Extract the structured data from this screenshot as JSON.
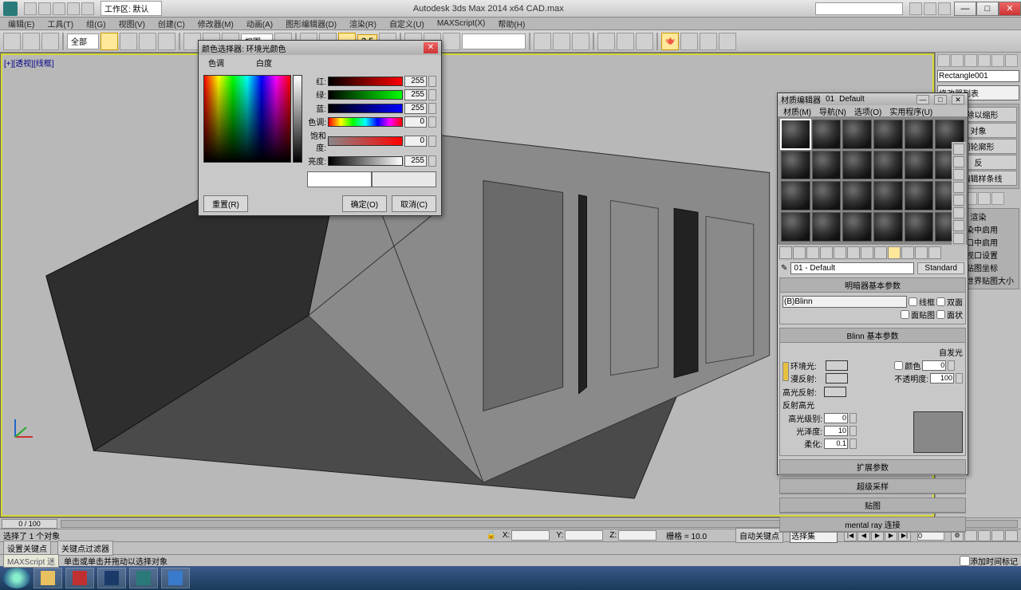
{
  "app": {
    "title": "Autodesk 3ds Max 2014 x64   CAD.max"
  },
  "menu": [
    "编辑(E)",
    "工具(T)",
    "组(G)",
    "视图(V)",
    "创建(C)",
    "修改器(M)",
    "动画(A)",
    "图形编辑器(D)",
    "渲染(R)",
    "自定义(U)",
    "MAXScript(X)",
    "帮助(H)"
  ],
  "toolbar": {
    "ref_dropdown": "全部",
    "coord_dropdown": "视图",
    "snap_value": "2.5"
  },
  "viewport": {
    "label": "[+][透视][线框]"
  },
  "color_picker": {
    "title": "颜色选择器: 环境光颜色",
    "tab_hue": "色调",
    "tab_white": "白度",
    "r_label": "红:",
    "r_val": "255",
    "g_label": "绿:",
    "g_val": "255",
    "b_label": "蓝:",
    "b_val": "255",
    "h_label": "色调:",
    "h_val": "0",
    "s_label": "饱和度:",
    "s_val": "0",
    "v_label": "亮度:",
    "v_val": "255",
    "reset": "重置(R)",
    "ok": "确定(O)",
    "cancel": "取消(C)"
  },
  "material": {
    "title": "材质编辑器",
    "slot_id": "01",
    "slot_name": "Default",
    "menu": [
      "材质(M)",
      "导航(N)",
      "选项(O)",
      "实用程序(U)"
    ],
    "name_drop": "01 - Default",
    "type_btn": "Standard",
    "rollout_shader": "明暗器基本参数",
    "shader_drop": "(B)Blinn",
    "cb_wire": "线框",
    "cb_2side": "双面",
    "cb_facemap": "面贴图",
    "cb_faceted": "面状",
    "rollout_blinn": "Blinn 基本参数",
    "self_illum": "自发光",
    "ambient": "环境光:",
    "diffuse": "漫反射:",
    "specular": "高光反射:",
    "color_cb": "颜色",
    "color_val": "0",
    "opacity": "不透明度:",
    "opacity_val": "100",
    "spec_hl": "反射高光",
    "spec_level": "高光级别:",
    "spec_level_val": "0",
    "gloss": "光泽度:",
    "gloss_val": "10",
    "soften": "柔化:",
    "soften_val": "0.1",
    "rollout_ext": "扩展参数",
    "rollout_ss": "超级采样",
    "rollout_maps": "贴图",
    "rollout_mr": "mental ray 连接"
  },
  "right": {
    "obj_name": "Rectangle001",
    "mod_drop": "修改器列表",
    "items": [
      "消除以缩形",
      "对象",
      "图轮廓形",
      "反",
      "可编辑样条线"
    ],
    "sec_label": "渲染",
    "sec_items": [
      "在渲染中启用",
      "在视口中启用",
      "使用视口设置",
      "生成贴图坐标",
      "真实世界贴图大小"
    ]
  },
  "timeline": {
    "frame": "0 / 100"
  },
  "status": {
    "sel": "选择了 1 个对象",
    "x": "X:",
    "y": "Y:",
    "z": "Z:",
    "grid": "栅格 = 10.0",
    "auto_key": "自动关键点",
    "set_key": "设置关键点",
    "keyfilter": "关键点过滤器",
    "selset": "选择集"
  },
  "prompt": {
    "cmd": "MAXScript 迷",
    "hint": "单击或单击并拖动以选择对象",
    "addtime": "添加时间标记"
  }
}
